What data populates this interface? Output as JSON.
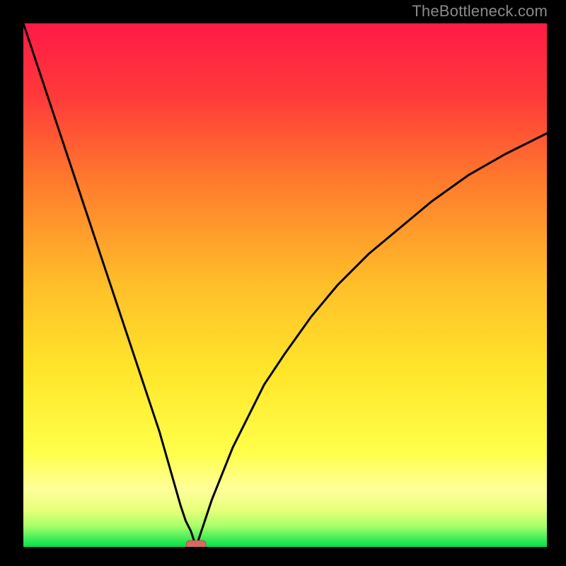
{
  "attribution": "TheBottleneck.com",
  "colors": {
    "page_background": "#000000",
    "gradient_top": "#ff1a46",
    "gradient_mid_upper": "#ff7a2c",
    "gradient_mid": "#ffe52a",
    "gradient_lower_band": "#ffff7a",
    "gradient_bottom_band": "#c7ff7a",
    "gradient_bottom": "#00e24c",
    "curve": "#000000",
    "marker_fill": "#d66a63",
    "marker_stroke": "#b64f49"
  },
  "chart_data": {
    "type": "line",
    "title": "",
    "xlabel": "",
    "ylabel": "",
    "x_range": [
      0,
      100
    ],
    "y_range": [
      0,
      100
    ],
    "notch_x": 33,
    "marker": {
      "x": 33,
      "y": 0
    },
    "series": [
      {
        "name": "bottleneck-curve",
        "x": [
          0,
          2,
          4,
          6,
          8,
          10,
          12,
          14,
          16,
          18,
          20,
          22,
          24,
          26,
          28,
          30,
          31,
          32,
          32.6,
          33,
          33.4,
          34,
          35,
          36,
          38,
          40,
          43,
          46,
          50,
          55,
          60,
          66,
          72,
          78,
          85,
          92,
          100
        ],
        "y": [
          100,
          94,
          88,
          82,
          76,
          70,
          64,
          58,
          52,
          46,
          40,
          34,
          28,
          22,
          15,
          8,
          5,
          3,
          1.2,
          0,
          1.2,
          3,
          6,
          9,
          14,
          19,
          25,
          31,
          37,
          44,
          50,
          56,
          61,
          66,
          71,
          75,
          79
        ]
      }
    ]
  }
}
